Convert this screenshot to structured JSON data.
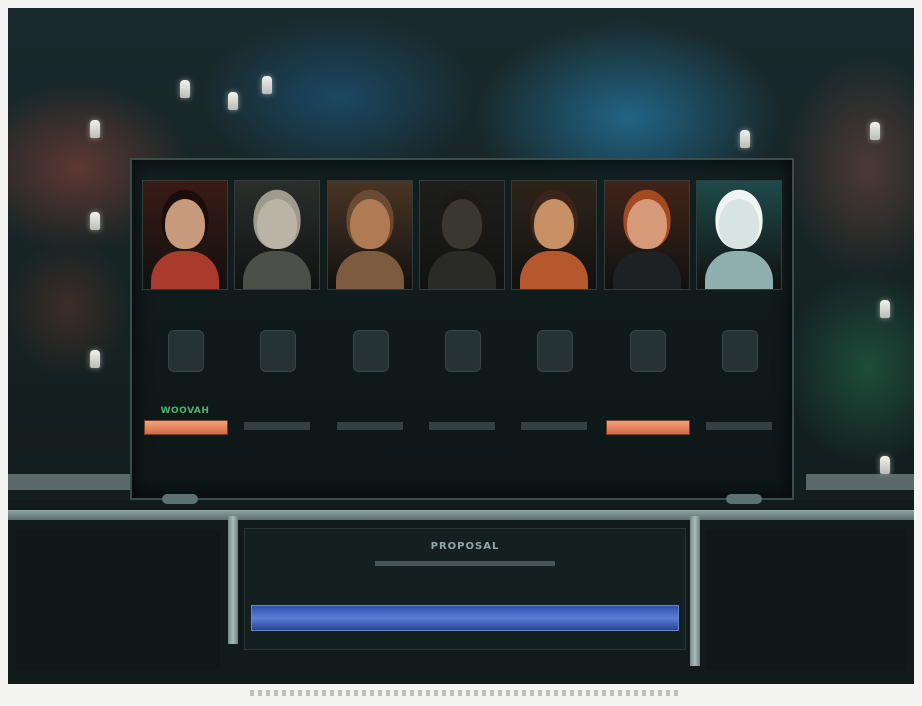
{
  "leaders": [
    {
      "id": "leader-1",
      "name": "",
      "status": "",
      "skin": "#c79a7c",
      "hair": "#1a0d0a",
      "clothes": "#a93a2c",
      "bg": "#3a1a14",
      "has_status_button": true
    },
    {
      "id": "leader-2",
      "name": "",
      "status": "",
      "skin": "#b9b4a6",
      "hair": "#9e9a8d",
      "clothes": "#4c4f4a",
      "bg": "#2a2f2c",
      "has_status_button": false
    },
    {
      "id": "leader-3",
      "name": "",
      "status": "",
      "skin": "#b07a55",
      "hair": "#6b4a33",
      "clothes": "#7d5b3f",
      "bg": "#4a3524",
      "has_status_button": false
    },
    {
      "id": "leader-4",
      "name": "",
      "status": "",
      "skin": "#3a3630",
      "hair": "#1c1a17",
      "clothes": "#2a2a26",
      "bg": "#1e1f1c",
      "has_status_button": false
    },
    {
      "id": "leader-5",
      "name": "",
      "status": "",
      "skin": "#c79065",
      "hair": "#3a2518",
      "clothes": "#b5582d",
      "bg": "#2e2418",
      "has_status_button": false
    },
    {
      "id": "leader-6",
      "name": "",
      "status": "",
      "skin": "#d79a78",
      "hair": "#a34a22",
      "clothes": "#1e2124",
      "bg": "#412418",
      "has_status_button": true
    },
    {
      "id": "leader-7",
      "name": "",
      "status": "",
      "skin": "#d8e4e2",
      "hair": "#f0f4f3",
      "clothes": "#8fb0ae",
      "bg": "#1f4a4a",
      "has_status_button": false
    }
  ],
  "status_labels": {
    "leader-1": "WOOVAH"
  },
  "proposal": {
    "title": "PROPOSAL"
  }
}
